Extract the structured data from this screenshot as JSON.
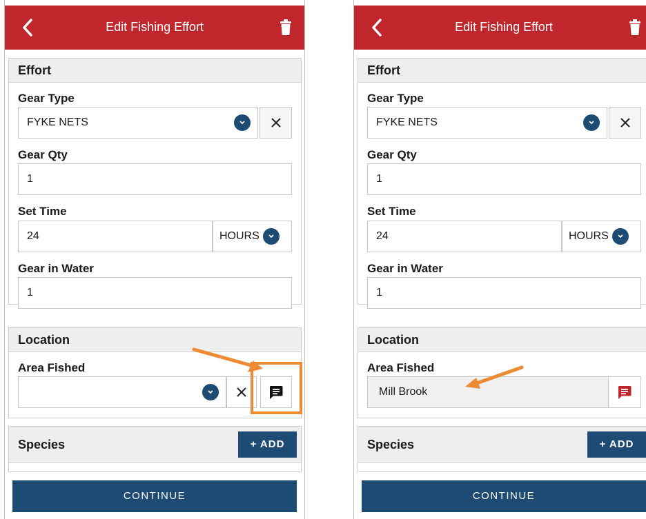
{
  "screens": [
    {
      "title": "Edit Fishing Effort",
      "effort": {
        "heading": "Effort",
        "gear_type_label": "Gear Type",
        "gear_type_value": "FYKE NETS",
        "gear_qty_label": "Gear Qty",
        "gear_qty_value": "1",
        "set_time_label": "Set Time",
        "set_time_value": "24",
        "set_time_unit": "HOURS",
        "gear_in_water_label": "Gear in Water",
        "gear_in_water_value": "1"
      },
      "location": {
        "heading": "Location",
        "area_label": "Area Fished",
        "area_value": ""
      },
      "species": {
        "heading": "Species",
        "add_label": "+ ADD"
      },
      "continue_label": "CONTINUE"
    },
    {
      "title": "Edit Fishing Effort",
      "effort": {
        "heading": "Effort",
        "gear_type_label": "Gear Type",
        "gear_type_value": "FYKE NETS",
        "gear_qty_label": "Gear Qty",
        "gear_qty_value": "1",
        "set_time_label": "Set Time",
        "set_time_value": "24",
        "set_time_unit": "HOURS",
        "gear_in_water_label": "Gear in Water",
        "gear_in_water_value": "1"
      },
      "location": {
        "heading": "Location",
        "area_label": "Area Fished",
        "area_value": "Mill Brook"
      },
      "species": {
        "heading": "Species",
        "add_label": "+ ADD"
      },
      "continue_label": "CONTINUE"
    }
  ],
  "colors": {
    "header": "#c0272d",
    "primary": "#1e4b73",
    "annotation": "#ee8a34",
    "comment_active": "#c0272d"
  },
  "icons": [
    "back-icon",
    "trash-icon",
    "chevron-down-icon",
    "close-icon",
    "comment-icon",
    "arrow-annotation-icon"
  ]
}
